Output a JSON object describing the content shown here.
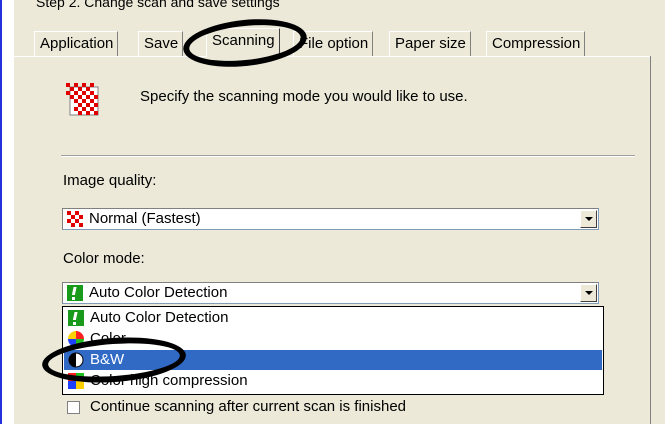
{
  "step_title": "Step 2. Change scan and save settings",
  "tabs": [
    {
      "label": "Application",
      "active": false
    },
    {
      "label": "Save",
      "active": false
    },
    {
      "label": "Scanning",
      "active": true
    },
    {
      "label": "File option",
      "active": false
    },
    {
      "label": "Paper size",
      "active": false
    },
    {
      "label": "Compression",
      "active": false
    }
  ],
  "header": {
    "text": "Specify the scanning mode you would like to use."
  },
  "image_quality": {
    "label": "Image quality:",
    "value": "Normal (Fastest)",
    "icon": "checker-icon"
  },
  "color_mode": {
    "label": "Color mode:",
    "value": "Auto Color Detection",
    "options": [
      {
        "label": "Auto Color Detection",
        "icon": "green-exclaim-icon"
      },
      {
        "label": "Color",
        "icon": "color-wheel-icon"
      },
      {
        "label": "B&W",
        "icon": "bw-icon",
        "selected": true
      },
      {
        "label": "Color high compression",
        "icon": "color-squares-icon"
      }
    ]
  },
  "behind_label_fragment": "S",
  "continue_scanning": {
    "label": "Continue scanning after current scan is finished",
    "checked": false
  },
  "colors": {
    "selection": "#316ac5",
    "panel": "#ece9d8",
    "annotation": "#000000"
  }
}
